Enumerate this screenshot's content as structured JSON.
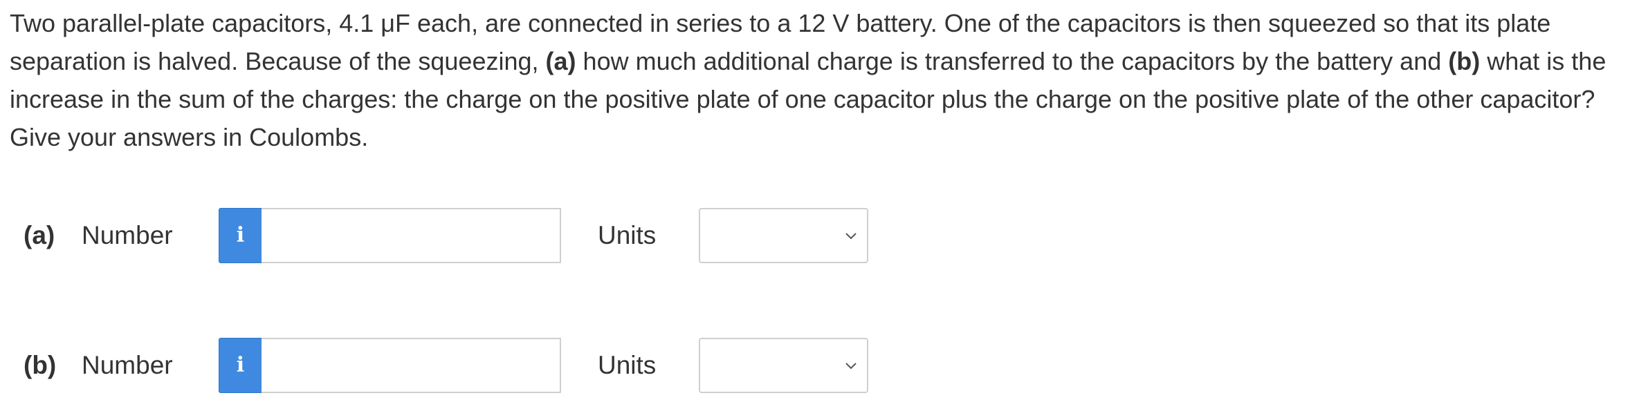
{
  "question": {
    "intro": "Two parallel-plate capacitors, 4.1 μF each, are connected in series to a 12 V battery. One of the capacitors is then squeezed so that its plate separation is halved. Because of the squeezing,",
    "part_a_marker": "(a)",
    "part_a_text": "how much additional charge is transferred to the capacitors by the battery and",
    "part_b_marker": "(b)",
    "part_b_text": "what is the increase in the sum of the charges: the charge on the positive plate of one capacitor plus the charge on the positive plate of the other capacitor? Give your answers in Coulombs."
  },
  "answers": [
    {
      "part_label": "(a)",
      "number_label": "Number",
      "info_icon": "info-icon",
      "info_glyph": "i",
      "number_value": "",
      "units_label": "Units",
      "units_selected": "",
      "dropdown_icon": "chevron-down-icon"
    },
    {
      "part_label": "(b)",
      "number_label": "Number",
      "info_icon": "info-icon",
      "info_glyph": "i",
      "number_value": "",
      "units_label": "Units",
      "units_selected": "",
      "dropdown_icon": "chevron-down-icon"
    }
  ],
  "colors": {
    "info_button": "#3f8ae0",
    "text": "#333333",
    "field_border": "#cfcfcf"
  }
}
